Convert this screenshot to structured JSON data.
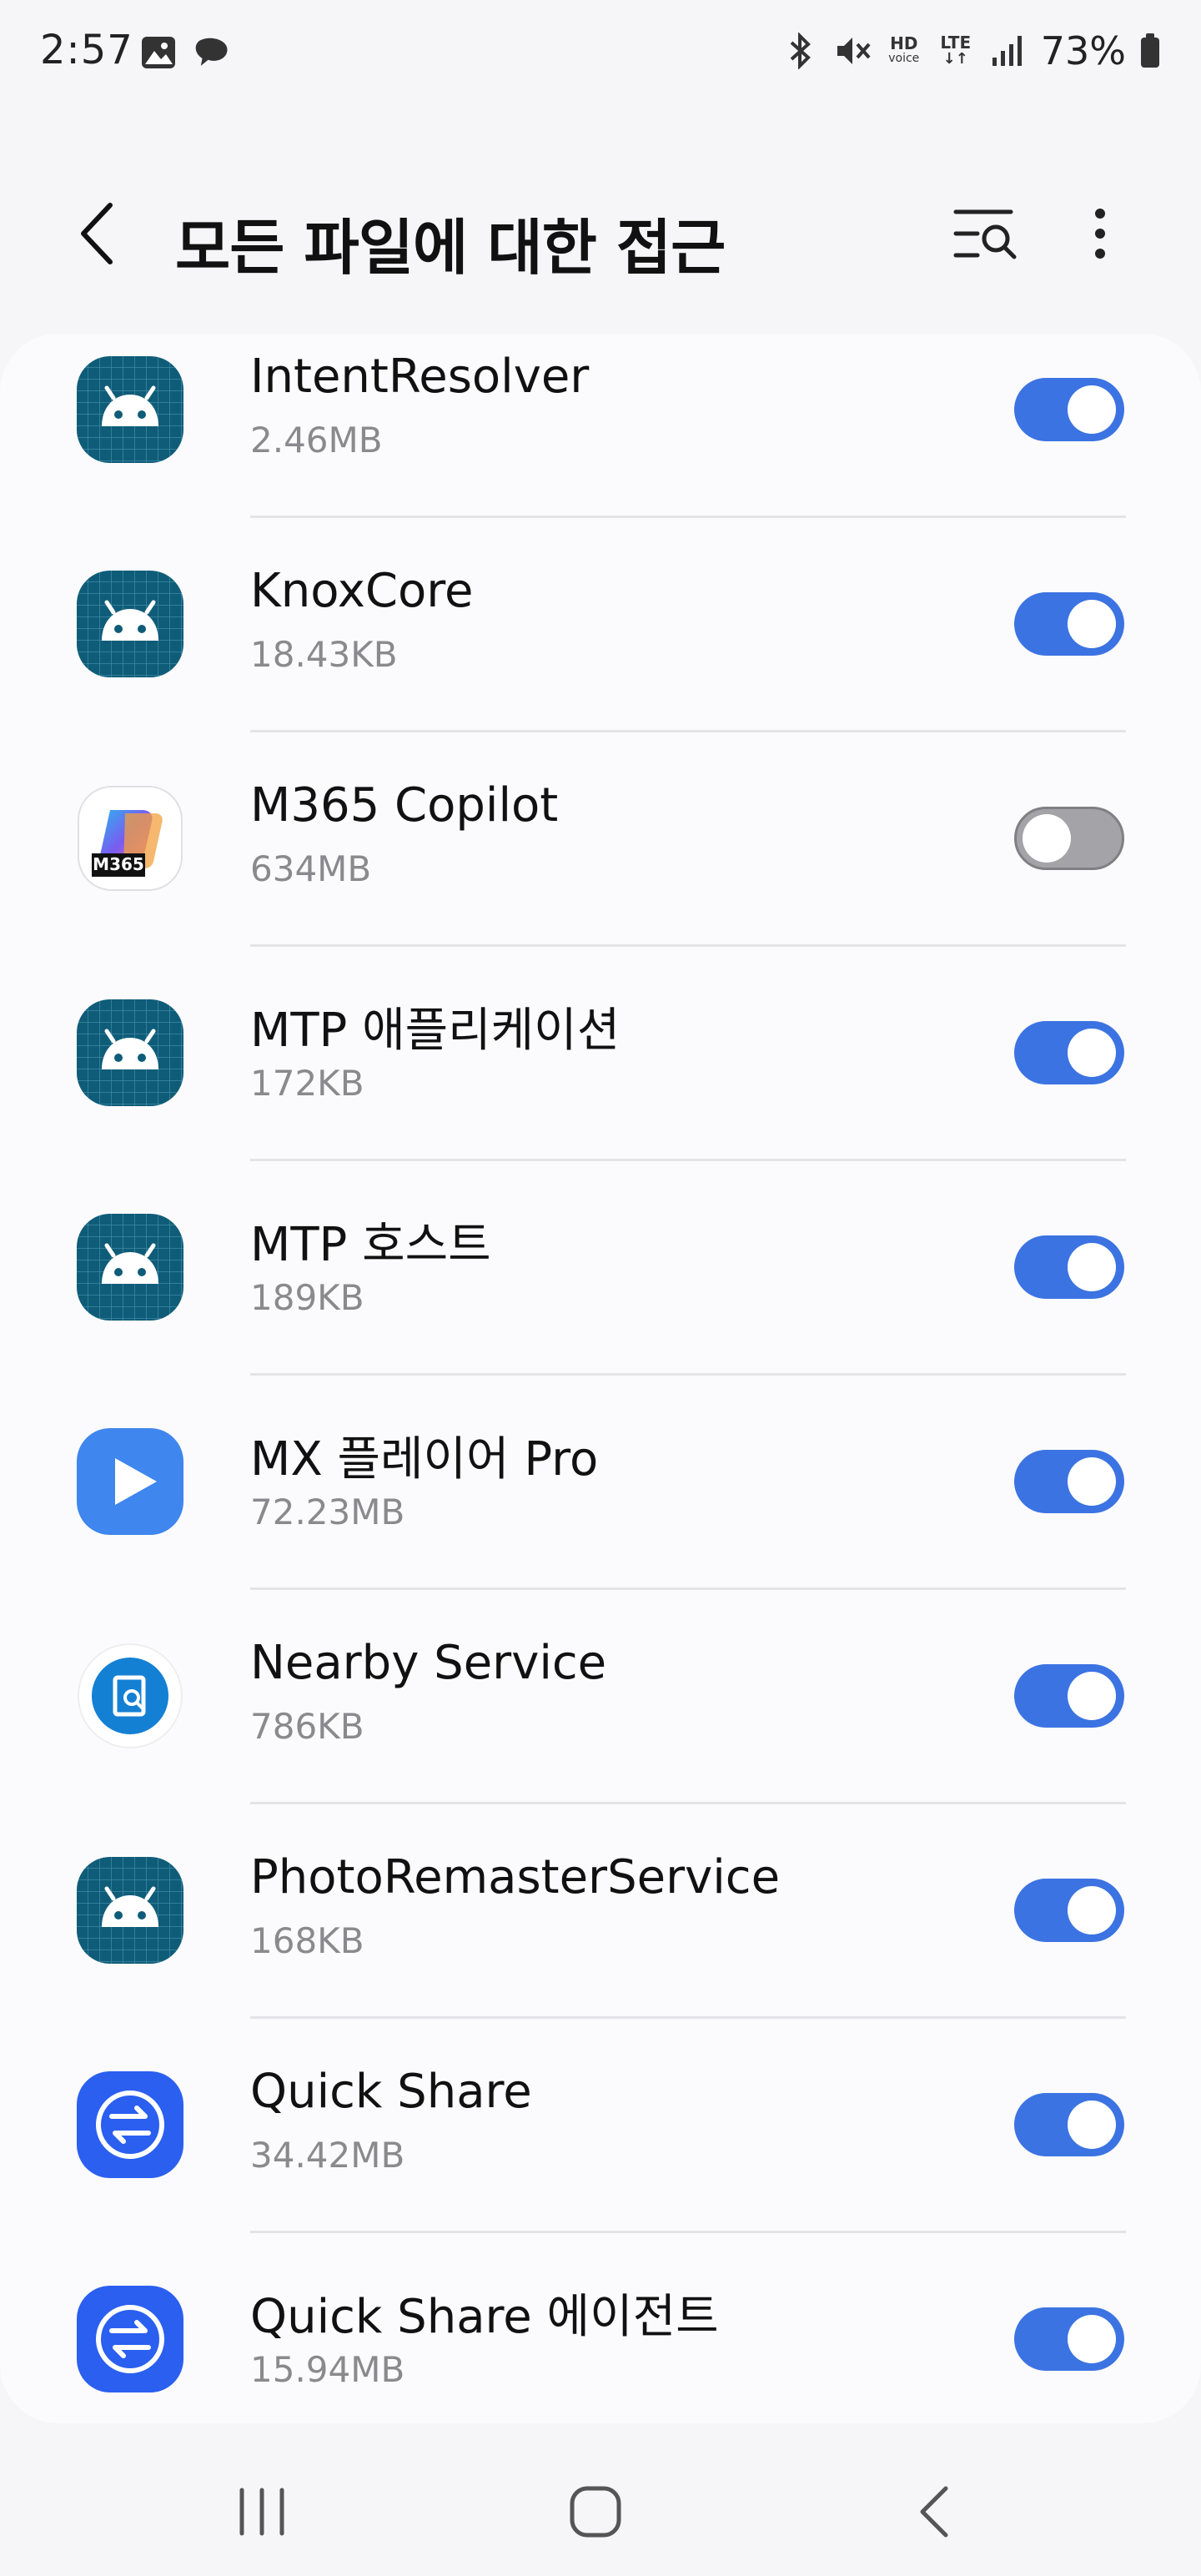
{
  "status_bar": {
    "time": "2:57",
    "left_icons": [
      "gallery-icon",
      "messenger-icon"
    ],
    "right_icons": [
      "bluetooth-icon",
      "mute-icon",
      "hd-voice-icon",
      "lte-icon",
      "signal-icon"
    ],
    "hd_label": "HD",
    "voice_label": "voice",
    "lte_label": "LTE",
    "battery_percent": "73%"
  },
  "header": {
    "title": "모든 파일에 대한 접근",
    "back_icon": "chevron-left-icon",
    "search_icon": "list-search-icon",
    "more_icon": "more-vertical-icon"
  },
  "apps": [
    {
      "name": "IntentResolver",
      "size": "2.46MB",
      "icon": "android-icon",
      "enabled": true
    },
    {
      "name": "KnoxCore",
      "size": "18.43KB",
      "icon": "android-icon",
      "enabled": true
    },
    {
      "name": "M365 Copilot",
      "size": "634MB",
      "icon": "m365-copilot-icon",
      "icon_label": "M365",
      "enabled": false
    },
    {
      "name": "MTP 애플리케이션",
      "size": "172KB",
      "icon": "android-icon",
      "enabled": true
    },
    {
      "name": "MTP 호스트",
      "size": "189KB",
      "icon": "android-icon",
      "enabled": true
    },
    {
      "name": "MX 플레이어 Pro",
      "size": "72.23MB",
      "icon": "play-icon",
      "enabled": true
    },
    {
      "name": "Nearby Service",
      "size": "786KB",
      "icon": "nearby-service-icon",
      "enabled": true
    },
    {
      "name": "PhotoRemasterService",
      "size": "168KB",
      "icon": "android-icon",
      "enabled": true
    },
    {
      "name": "Quick Share",
      "size": "34.42MB",
      "icon": "quick-share-icon",
      "enabled": true
    },
    {
      "name": "Quick Share 에이전트",
      "size": "15.94MB",
      "icon": "quick-share-icon",
      "enabled": true
    }
  ],
  "colors": {
    "toggle_on": "#3c73e2",
    "toggle_off": "#a3a3a8",
    "android_icon_bg": "#0f5c78",
    "mx_player_bg": "#3f86ee",
    "quick_share_bg": "#2a5ff0"
  },
  "nav_bar": {
    "recent_icon": "recent-apps-icon",
    "home_icon": "home-icon",
    "back_icon": "back-icon"
  }
}
